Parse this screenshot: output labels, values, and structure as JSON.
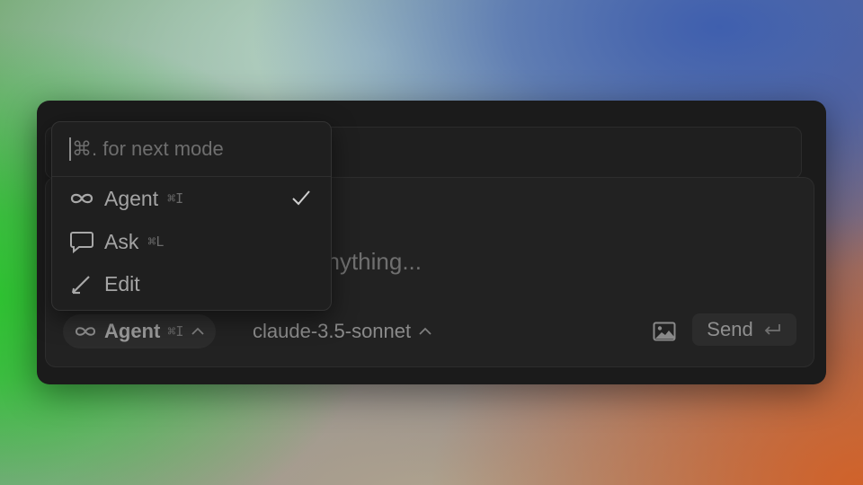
{
  "composer": {
    "placeholder": "Plan, search, build anything..."
  },
  "mode_menu": {
    "search_placeholder": "⌘. for next mode",
    "items": [
      {
        "label": "Agent",
        "shortcut": "⌘I",
        "icon": "infinity-icon",
        "selected": true
      },
      {
        "label": "Ask",
        "shortcut": "⌘L",
        "icon": "chat-bubble-icon",
        "selected": false
      },
      {
        "label": "Edit",
        "shortcut": "",
        "icon": "pencil-icon",
        "selected": false
      }
    ]
  },
  "toolbar": {
    "mode_label": "Agent",
    "mode_shortcut": "⌘I",
    "model_label": "claude-3.5-sonnet",
    "send_label": "Send"
  },
  "colors": {
    "panel": "#1b1b1b",
    "menu": "#1f1f1f",
    "text_muted": "#a4a4a4"
  }
}
